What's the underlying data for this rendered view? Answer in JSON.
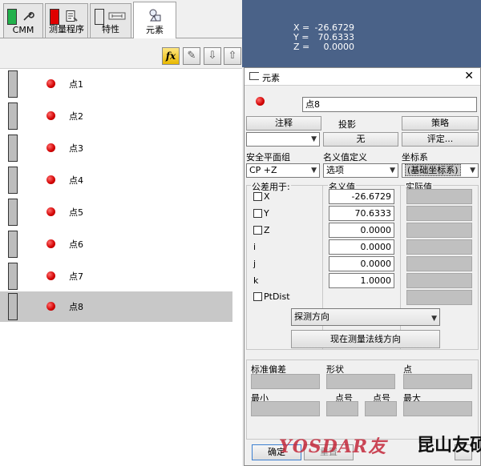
{
  "tabs": [
    {
      "label": "CMM",
      "status_color": "#22b14c",
      "icon": "wrench-icon"
    },
    {
      "label": "测量程序",
      "status_color": "#e00000",
      "icon": "program-icon"
    },
    {
      "label": "特性",
      "status_color": "#e6e6e6",
      "icon": "feature-icon"
    },
    {
      "label": "元素",
      "icon": "elements-icon",
      "active": true
    }
  ],
  "toolbar": [
    {
      "icon": "formula-fx-icon",
      "glyph": "fx"
    },
    {
      "icon": "pencil-icon",
      "glyph": "✎"
    },
    {
      "icon": "arrow-down-icon",
      "glyph": "⇩"
    },
    {
      "icon": "arrow-up-icon",
      "glyph": "⇧"
    }
  ],
  "element_list": [
    {
      "label": "点1"
    },
    {
      "label": "点2"
    },
    {
      "label": "点3"
    },
    {
      "label": "点4"
    },
    {
      "label": "点5"
    },
    {
      "label": "点6"
    },
    {
      "label": "点7"
    },
    {
      "label": "点8",
      "selected": true
    }
  ],
  "viewer": {
    "x_label": "X =",
    "x_value": "-26.6729",
    "y_label": "Y =",
    "y_value": "70.6333",
    "z_label": "Z =",
    "z_value": "0.0000"
  },
  "dialog": {
    "title": "元素",
    "close_glyph": "✕",
    "name_value": "点8",
    "comment_button": "注释",
    "projection_label": "投影",
    "strategy_button": "策略",
    "projection_value": "无",
    "evaluate_button": "评定...",
    "safety_plane_label": "安全平面组",
    "nominal_def_label": "名义值定义",
    "coord_system_label": "坐标系",
    "safety_plane_value": "CP +Z",
    "nominal_def_value": "选项",
    "coord_system_value": "(基础坐标系)",
    "tolerance_for_label": "公差用于:",
    "nominal_header": "名义值",
    "actual_header": "实际值",
    "rows": [
      {
        "label": "X",
        "checkbox": true,
        "value": "-26.6729"
      },
      {
        "label": "Y",
        "checkbox": true,
        "value": "70.6333"
      },
      {
        "label": "Z",
        "checkbox": true,
        "value": "0.0000"
      },
      {
        "label": "i",
        "checkbox": false,
        "value": "0.0000"
      },
      {
        "label": "j",
        "checkbox": false,
        "value": "0.0000"
      },
      {
        "label": "k",
        "checkbox": false,
        "value": "1.0000"
      },
      {
        "label": "PtDist",
        "checkbox": true,
        "value": ""
      }
    ],
    "probe_direction_value": "探测方向",
    "current_normal_button": "现在测量法线方向",
    "std_dev_label": "标准偏差",
    "form_label": "形状",
    "point_label": "点",
    "min_label": "最小",
    "point_no_label_1": "点号",
    "point_no_label_2": "点号",
    "max_label": "最大",
    "ok_button": "确定",
    "reset_button": "重置"
  },
  "watermark": {
    "latin": "YOSDAR友",
    "chinese": "昆山友硕"
  }
}
